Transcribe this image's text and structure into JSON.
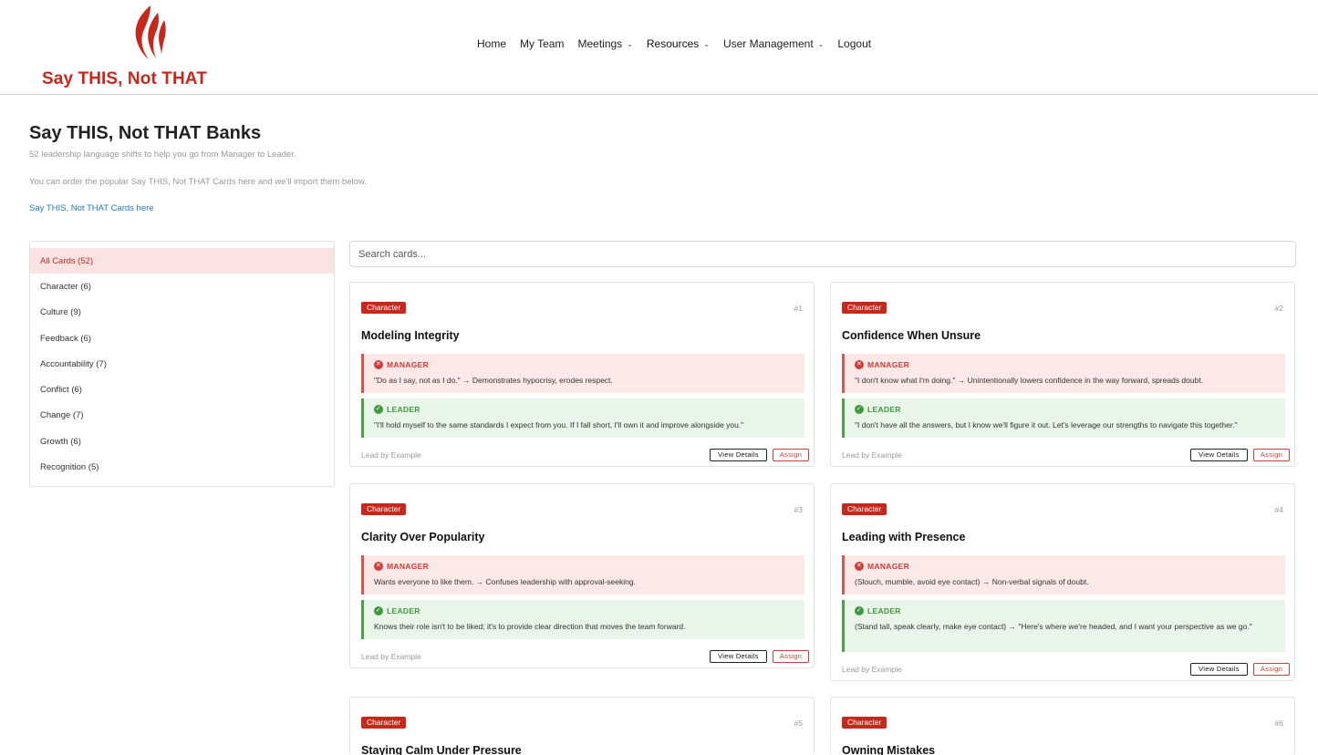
{
  "brand": {
    "name": "Say THIS, Not THAT",
    "accent": "#c8281c"
  },
  "nav": {
    "home": "Home",
    "my_team": "My Team",
    "meetings": "Meetings",
    "resources": "Resources",
    "user_management": "User Management",
    "logout": "Logout"
  },
  "page": {
    "title": "Say THIS, Not THAT Banks",
    "subtitle": "52 leadership language shifts to help you go from Manager to Leader.",
    "order_text": "You can order the popular Say THIS, Not THAT Cards here and we'll import them below.",
    "order_link": "Say THIS, Not THAT Cards here"
  },
  "categories": [
    {
      "label": "All Cards (52)",
      "active": true
    },
    {
      "label": "Character (6)"
    },
    {
      "label": "Culture (9)"
    },
    {
      "label": "Feedback (6)"
    },
    {
      "label": "Accountability (7)"
    },
    {
      "label": "Conflict (6)"
    },
    {
      "label": "Change (7)"
    },
    {
      "label": "Growth (6)"
    },
    {
      "label": "Recognition (5)"
    }
  ],
  "search": {
    "placeholder": "Search cards..."
  },
  "labels": {
    "manager": "MANAGER",
    "leader": "LEADER",
    "view_details": "View Details",
    "assign": "Assign"
  },
  "cards": [
    {
      "category": "Character",
      "number": "#1",
      "title": "Modeling Integrity",
      "manager": "\"Do as I say, not as I do.\" → Demonstrates hypocrisy, erodes respect.",
      "leader": "\"I'll hold myself to the same standards I expect from you. If I fall short, I'll own it and improve alongside you.\"",
      "footer": "Lead by Example"
    },
    {
      "category": "Character",
      "number": "#2",
      "title": "Confidence When Unsure",
      "manager": "\"I don't know what I'm doing.\" → Unintentionally lowers confidence in the way forward, spreads doubt.",
      "leader": "\"I don't have all the answers, but I know we'll figure it out. Let's leverage our strengths to navigate this together.\"",
      "footer": "Lead by Example"
    },
    {
      "category": "Character",
      "number": "#3",
      "title": "Clarity Over Popularity",
      "manager": "Wants everyone to like them. → Confuses leadership with approval-seeking.",
      "leader": "Knows their role isn't to be liked; it's to provide clear direction that moves the team forward.",
      "footer": "Lead by Example"
    },
    {
      "category": "Character",
      "number": "#4",
      "title": "Leading with Presence",
      "manager": "(Slouch, mumble, avoid eye contact) → Non-verbal signals of doubt.",
      "leader": "(Stand tall, speak clearly, make eye contact) → \"Here's where we're headed, and I want your perspective as we go.\"",
      "footer": "Lead by Example"
    },
    {
      "category": "Character",
      "number": "#5",
      "title": "Staying Calm Under Pressure"
    },
    {
      "category": "Character",
      "number": "#6",
      "title": "Owning Mistakes"
    }
  ]
}
